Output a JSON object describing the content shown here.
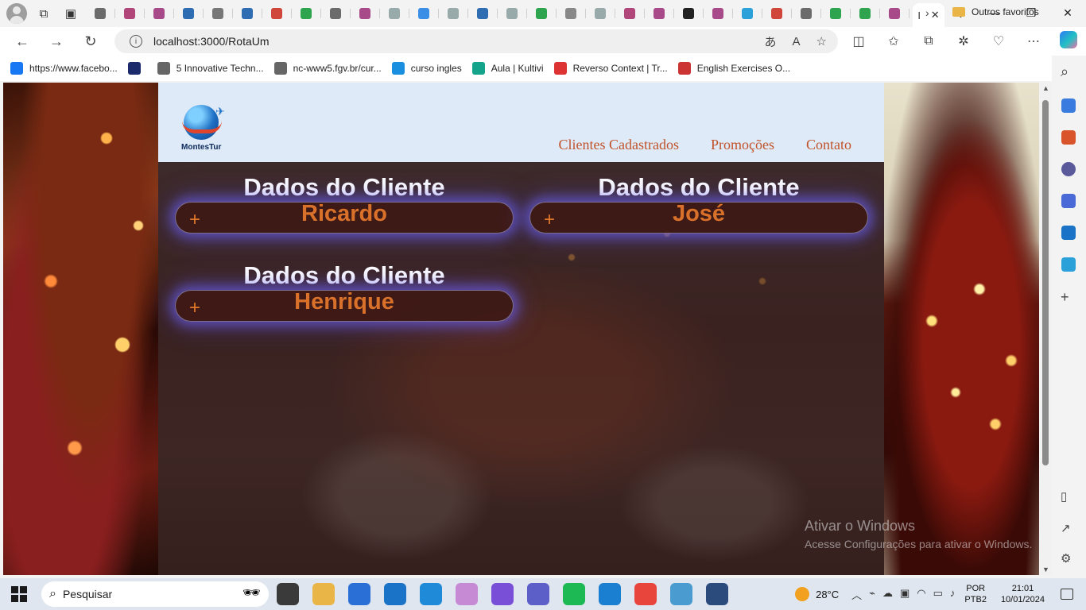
{
  "browser": {
    "tabs": {
      "tab_icon_colors": [
        "#6b6b6b",
        "#b0467a",
        "#a84a8a",
        "#2f6db3",
        "#777",
        "#2f6db3",
        "#d0463a",
        "#2ea44f",
        "#6b6b6b",
        "#a84a8a",
        "#9aa",
        "#3a8ee6",
        "#9aa",
        "#2f6db3",
        "#9aa",
        "#2ea44f",
        "#888",
        "#9aa",
        "#b0467a",
        "#a84a8a",
        "#222",
        "#a84a8a",
        "#2aa1d8",
        "#d0463a",
        "#6b6b6b",
        "#2ea44f",
        "#2ea44f",
        "#a84a8a"
      ],
      "active_tab_label": "I",
      "active_tab_close": "✕",
      "new_tab": "+"
    },
    "window_controls": {
      "minimize": "—",
      "maximize": "❐",
      "close": "✕"
    },
    "address": {
      "url": "localhost:3000/RotaUm"
    },
    "favorites": [
      {
        "label": "https://www.facebo...",
        "icon": "facebook-icon",
        "color": "#1877f2"
      },
      {
        "label": "",
        "icon": "ssw-icon",
        "color": "#1b2a6b"
      },
      {
        "label": "5 Innovative Techn...",
        "icon": "page-icon",
        "color": "#666"
      },
      {
        "label": "nc-www5.fgv.br/cur...",
        "icon": "page-icon",
        "color": "#666"
      },
      {
        "label": "curso ingles",
        "icon": "square-icon",
        "color": "#1a8fe0"
      },
      {
        "label": "Aula | Kultivi",
        "icon": "kultivi-icon",
        "color": "#14a38b"
      },
      {
        "label": "Reverso Context | Tr...",
        "icon": "reverso-icon",
        "color": "#d33"
      },
      {
        "label": "English Exercises O...",
        "icon": "ee-icon",
        "color": "#c33"
      }
    ],
    "favorites_folder": "Outros favoritos"
  },
  "page": {
    "brand": "MontesTur",
    "menu": [
      "Clientes Cadastrados",
      "Promoções",
      "Contato"
    ],
    "cards": [
      {
        "title": "Dados do Cliente",
        "name": "Ricardo",
        "expand": "+"
      },
      {
        "title": "Dados do Cliente",
        "name": "José",
        "expand": "+"
      },
      {
        "title": "Dados do Cliente",
        "name": "Henrique",
        "expand": "+"
      }
    ],
    "colors": {
      "header_bg": "#dfeaf9",
      "menu_text": "#c0532a",
      "card_name": "#d9712a",
      "card_glow": "#6e64ff"
    }
  },
  "watermark": {
    "line1": "Ativar o Windows",
    "line2": "Acesse Configurações para ativar o Windows."
  },
  "taskbar": {
    "search_placeholder": "Pesquisar",
    "weather": "28°C",
    "lang_top": "POR",
    "lang_bottom": "PTB2",
    "time": "21:01",
    "date": "10/01/2024",
    "apps": [
      {
        "name": "task-view",
        "color": "#3a3a3a"
      },
      {
        "name": "file-explorer",
        "color": "#e8b546"
      },
      {
        "name": "microsoft-store",
        "color": "#2a6fd6"
      },
      {
        "name": "mail",
        "color": "#1a73c7"
      },
      {
        "name": "edge",
        "color": "#1f8ad8"
      },
      {
        "name": "paint",
        "color": "#c58ad3"
      },
      {
        "name": "clipchamp",
        "color": "#7a4fd8"
      },
      {
        "name": "teams",
        "color": "#5b5fc7"
      },
      {
        "name": "spotify",
        "color": "#1db954"
      },
      {
        "name": "vscode",
        "color": "#1a7fd0"
      },
      {
        "name": "chrome",
        "color": "#e8453c"
      },
      {
        "name": "notepad",
        "color": "#4a9bd0"
      },
      {
        "name": "mysql-workbench",
        "color": "#2a4b7c"
      }
    ]
  }
}
